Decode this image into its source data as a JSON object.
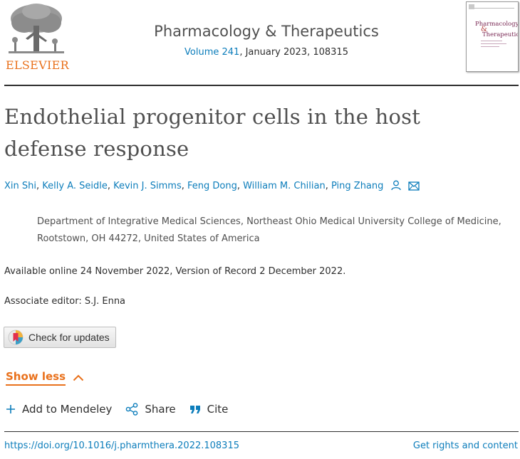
{
  "header": {
    "publisher_logo_text": "ELSEVIER",
    "journal_title": "Pharmacology & Therapeutics",
    "volume_link": "Volume 241",
    "issue_detail": ", January 2023, 108315",
    "cover": {
      "line1": "Pharmacology",
      "amp": "&",
      "line2": "Therapeutics"
    }
  },
  "article": {
    "title": "Endothelial progenitor cells in the host defense response",
    "authors": [
      "Xin Shi",
      "Kelly A. Seidle",
      "Kevin J. Simms",
      "Feng Dong",
      "William M. Chilian",
      "Ping Zhang"
    ],
    "author_separator": ", ",
    "affiliation": "Department of Integrative Medical Sciences, Northeast Ohio Medical University College of Medicine, Rootstown, OH 44272, United States of America",
    "available_online": "Available online 24 November 2022, Version of Record 2 December 2022.",
    "associate_editor": "Associate editor: S.J. Enna"
  },
  "buttons": {
    "check_for_updates": "Check for updates",
    "show_less": "Show less"
  },
  "actions": [
    {
      "label": "Add to Mendeley",
      "icon": "plus-icon"
    },
    {
      "label": "Share",
      "icon": "share-icon"
    },
    {
      "label": "Cite",
      "icon": "quote-icon"
    }
  ],
  "footer": {
    "doi": "https://doi.org/10.1016/j.pharmthera.2022.108315",
    "rights": "Get rights and content"
  },
  "colors": {
    "link": "#0c7dbb",
    "accent": "#e9711c",
    "text": "#2e2e2e",
    "title": "#505050"
  }
}
